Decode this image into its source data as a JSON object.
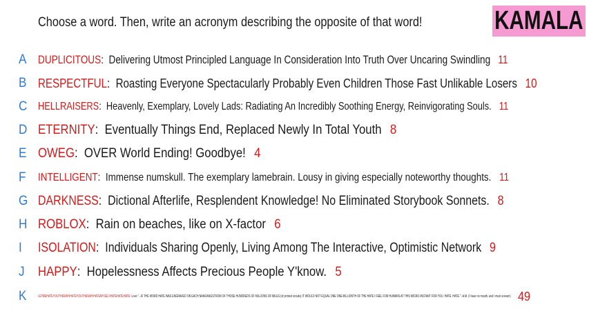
{
  "prompt": "Choose a word. Then, write an acronym describing the opposite of that word!",
  "badge": {
    "label": "KAMALA",
    "color": "#f59bd2"
  },
  "colors": {
    "letter": "#2e7bd6",
    "word": "#d41a1a",
    "text": "#1a1a1a"
  },
  "rows": [
    {
      "letter": "A",
      "word": "DUPLICITOUS",
      "acronym": "Delivering Utmost Principled Language In Consideration Into Truth Over Uncaring Swindling",
      "count": "11"
    },
    {
      "letter": "B",
      "word": "RESPECTFUL",
      "acronym": "Roasting Everyone Spectacularly Probably  Even Children  Those Fast Unlikable Losers",
      "count": "10"
    },
    {
      "letter": "C",
      "word": "HELLRAISERS",
      "acronym": "Heavenly, Exemplary, Lovely Lads: Radiating An Incredibly Soothing Energy, Reinvigorating Souls.",
      "count": "11"
    },
    {
      "letter": "D",
      "word": "ETERNITY",
      "acronym": "Eventually Things End, Replaced Newly In Total Youth",
      "count": "8"
    },
    {
      "letter": "E",
      "word": "OWEG",
      "acronym": "OVER World Ending! Goodbye!",
      "count": "4"
    },
    {
      "letter": "F",
      "word": "INTELLIGENT",
      "acronym": "Immense numskull. The exemplary lamebrain. Lousy in giving especially noteworthy thoughts.",
      "count": "11"
    },
    {
      "letter": "G",
      "word": "DARKNESS",
      "acronym": "Dictional Afterlife, Resplendent Knowledge! No Eliminated Storybook Sonnets.",
      "count": "8"
    },
    {
      "letter": "H",
      "word": "ROBLOX",
      "acronym": "Rain on beaches, like on X-factor",
      "count": "6"
    },
    {
      "letter": "I",
      "word": "ISOLATION",
      "acronym": "Individuals Sharing Openly, Living Among The Interactive, Optimistic Network",
      "count": "9"
    },
    {
      "letter": "J",
      "word": "HAPPY",
      "acronym": "Hopelessness Affects Precious People Y'know.",
      "count": "5"
    }
  ],
  "row_k": {
    "letter": "K",
    "word": "LETMEHATEYOUTHEWAYIHATEYOUTHEWAYIHATEMYSELFHATEHATEHATE",
    "acronym": "Love \"...IF THE WORD HATE WAS ENGRAVED ON EACH NANOANGSTROM OF THOSE HUNDREDS OF MILLIONS OF MILES (of printed circuits) IT WOULD NOT EQUAL ONE ONE-BILLIONTH OF THE HATE I FEEL FOR HUMANS AT THIS MICRO-INSTANT FOR YOU. HATE. HATE.\" -A.M. (I have no mouth, and I must scream)",
    "count": "49"
  }
}
